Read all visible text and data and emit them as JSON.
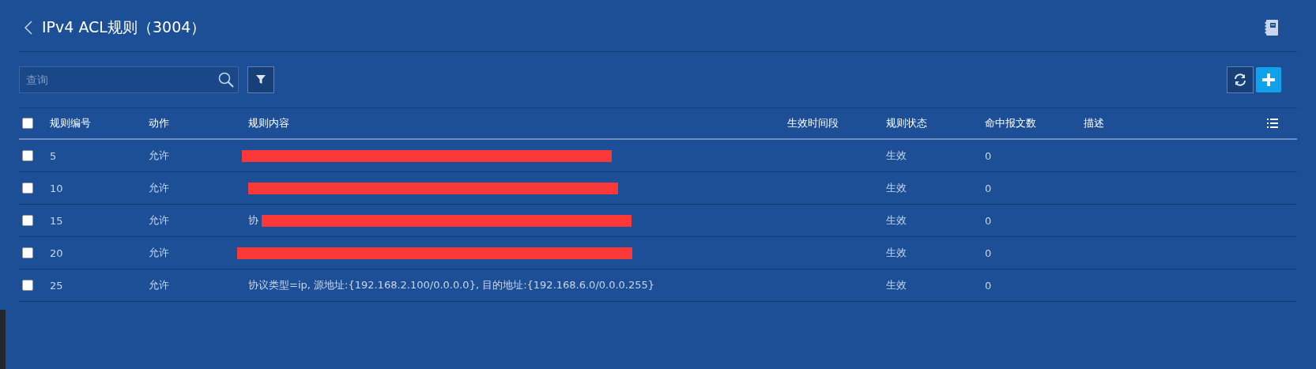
{
  "title": "IPv4 ACL规则（3004）",
  "search": {
    "placeholder": "查询"
  },
  "table": {
    "columns": [
      "规则编号",
      "动作",
      "规则内容",
      "生效时间段",
      "规则状态",
      "命中报文数",
      "描述"
    ],
    "all_checked": false,
    "rows": [
      {
        "checked": false,
        "id": "5",
        "action": "允许",
        "redacted": true,
        "status": "生效",
        "hits": "0"
      },
      {
        "checked": false,
        "id": "10",
        "action": "允许",
        "redacted": true,
        "status": "生效",
        "hits": "0"
      },
      {
        "checked": false,
        "id": "15",
        "action": "允许",
        "content": "协",
        "redacted": true,
        "status": "生效",
        "hits": "0"
      },
      {
        "checked": false,
        "id": "20",
        "action": "允许",
        "redacted": true,
        "status": "生效",
        "hits": "0"
      },
      {
        "checked": false,
        "id": "25",
        "action": "允许",
        "content": "协议类型=ip, 源地址:{192.168.2.100/0.0.0.0}, 目的地址:{192.168.6.0/0.0.0.255}",
        "redacted": false,
        "status": "生效",
        "hits": "0"
      }
    ]
  }
}
